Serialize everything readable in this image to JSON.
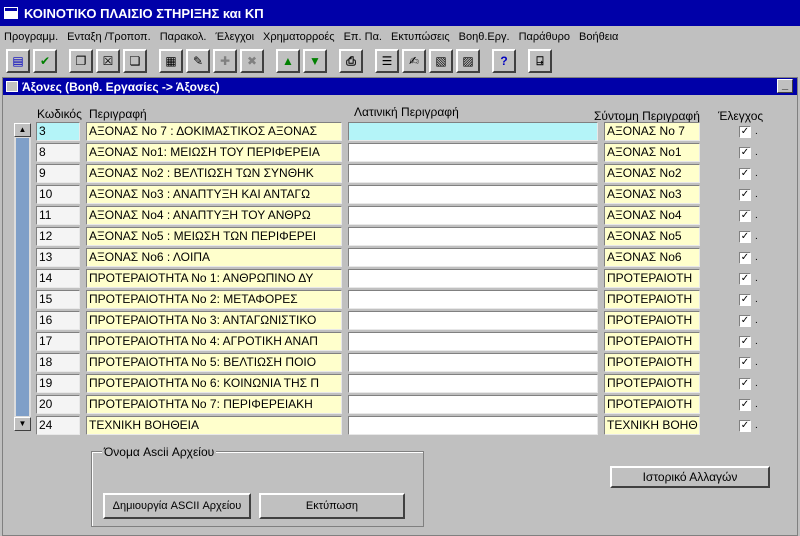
{
  "window": {
    "title": "ΚΟΙΝΟΤΙΚΟ ΠΛΑΙΣΙΟ ΣΤΗΡΙΞΗΣ και ΚΠ"
  },
  "menu": [
    "Προγραμμ.",
    "Ενταξη /Τροποπ.",
    "Παρακολ.",
    "Έλεγχοι",
    "Χρηματορροές",
    "Επ. Πα.",
    "Εκτυπώσεις",
    "Βοηθ.Εργ.",
    "Παράθυρο",
    "Βοήθεια"
  ],
  "toolbar": {
    "icons": [
      "save-icon",
      "check-icon",
      "copy-record-icon",
      "delete-record-icon",
      "paste-record-icon",
      "query-icon",
      "edit-icon",
      "insert-record-icon",
      "remove-record-icon",
      "up-arrow-icon",
      "down-arrow-icon",
      "print-icon",
      "list-icon",
      "notes-icon",
      "document-icon",
      "clipboard-icon",
      "help-icon",
      "exit-icon"
    ],
    "glyphs": [
      "▤",
      "✔",
      "❐",
      "☒",
      "❏",
      "▦",
      "✎",
      "✚",
      "✖",
      "▲",
      "▼",
      "⎙",
      "☰",
      "✍",
      "▧",
      "▨",
      "?",
      "⍈"
    ]
  },
  "subwindow": {
    "title": "Άξονες (Βοηθ. Εργασίες -> Άξονες)"
  },
  "columns": {
    "code": "Κωδικός",
    "description": "Περιγραφή",
    "latin": "Λατινική Περιγραφή",
    "short": "Σύντομη Περιγραφή",
    "checks": "Έλεγχος"
  },
  "rows": [
    {
      "code": "3",
      "description": "ΑΞΟΝΑΣ Νο 7 : ΔΟΚΙΜΑΣΤΙΚΟΣ ΑΞΟΝΑΣ",
      "latin": "",
      "short": "ΑΞΟΝΑΣ Νο 7"
    },
    {
      "code": "8",
      "description": "ΑΞΟΝΑΣ Νο1: ΜΕΙΩΣΗ ΤΟΥ ΠΕΡΙΦΕΡΕΙΑ",
      "latin": "",
      "short": "ΑΞΟΝΑΣ Νο1"
    },
    {
      "code": "9",
      "description": "ΑΞΟΝΑΣ Νο2 : ΒΕΛΤΙΩΣΗ ΤΩΝ ΣΥΝΘΗΚ",
      "latin": "",
      "short": "ΑΞΟΝΑΣ Νο2"
    },
    {
      "code": "10",
      "description": "ΑΞΟΝΑΣ Νο3 : ΑΝΑΠΤΥΞΗ ΚΑΙ ΑΝΤΑΓΩ",
      "latin": "",
      "short": "ΑΞΟΝΑΣ Νο3"
    },
    {
      "code": "11",
      "description": "ΑΞΟΝΑΣ Νο4 : ΑΝΑΠΤΥΞΗ ΤΟΥ ΑΝΘΡΩ",
      "latin": "",
      "short": "ΑΞΟΝΑΣ Νο4"
    },
    {
      "code": "12",
      "description": "ΑΞΟΝΑΣ Νο5 : ΜΕΙΩΣΗ ΤΩΝ ΠΕΡΙΦΕΡΕΙ",
      "latin": "",
      "short": "ΑΞΟΝΑΣ Νο5"
    },
    {
      "code": "13",
      "description": "ΑΞΟΝΑΣ Νο6 : ΛΟΙΠΑ",
      "latin": "",
      "short": "ΑΞΟΝΑΣ Νο6"
    },
    {
      "code": "14",
      "description": "ΠΡΟΤΕΡΑΙΟΤΗΤΑ Νο 1: ΑΝΘΡΩΠΙΝΟ ΔΥ",
      "latin": "",
      "short": "ΠΡΟΤΕΡΑΙΟΤΗ"
    },
    {
      "code": "15",
      "description": "ΠΡΟΤΕΡΑΙΟΤΗΤΑ Νο 2: ΜΕΤΑΦΟΡΕΣ",
      "latin": "",
      "short": "ΠΡΟΤΕΡΑΙΟΤΗ"
    },
    {
      "code": "16",
      "description": "ΠΡΟΤΕΡΑΙΟΤΗΤΑ Νο 3: ΑΝΤΑΓΩΝΙΣΤΙΚΟ",
      "latin": "",
      "short": "ΠΡΟΤΕΡΑΙΟΤΗ"
    },
    {
      "code": "17",
      "description": "ΠΡΟΤΕΡΑΙΟΤΗΤΑ Νο 4: ΑΓΡΟΤΙΚΗ ΑΝΑΠ",
      "latin": "",
      "short": "ΠΡΟΤΕΡΑΙΟΤΗ"
    },
    {
      "code": "18",
      "description": "ΠΡΟΤΕΡΑΙΟΤΗΤΑ Νο 5: ΒΕΛΤΙΩΣΗ ΠΟΙΟ",
      "latin": "",
      "short": "ΠΡΟΤΕΡΑΙΟΤΗ"
    },
    {
      "code": "19",
      "description": "ΠΡΟΤΕΡΑΙΟΤΗΤΑ Νο 6: ΚΟΙΝΩΝΙΑ ΤΗΣ Π",
      "latin": "",
      "short": "ΠΡΟΤΕΡΑΙΟΤΗ"
    },
    {
      "code": "20",
      "description": "ΠΡΟΤΕΡΑΙΟΤΗΤΑ Νο 7: ΠΕΡΙΦΕΡΕΙΑΚΗ",
      "latin": "",
      "short": "ΠΡΟΤΕΡΑΙΟΤΗ"
    },
    {
      "code": "24",
      "description": "ΤΕΧΝΙΚΗ ΒΟΗΘΕΙΑ",
      "latin": "",
      "short": "ΤΕΧΝΙΚΗ ΒΟΗΘ"
    }
  ],
  "checkmark": "✓",
  "row_marker": ".",
  "scroll": {
    "up": "▲",
    "down": "▼"
  },
  "ascii_group": {
    "label": "Όνομα Ascii Αρχείου",
    "create_button": "Δημιουργία  ASCII Αρχείου",
    "print_button": "Εκτύπωση"
  },
  "history_button": "Ιστορικό Αλλαγών",
  "minimize_glyph": "_"
}
